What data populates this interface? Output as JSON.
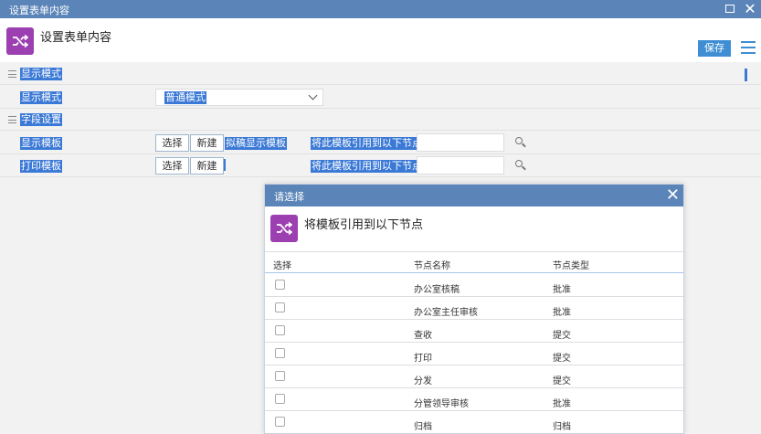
{
  "window": {
    "title": "设置表单内容"
  },
  "header": {
    "title": "设置表单内容",
    "save_label": "保存",
    "icon": "shuffle-icon",
    "list_icon": "list-icon"
  },
  "sections": {
    "display": {
      "label": "显示模式",
      "field_label": "显示模式",
      "select_value": "普通模式"
    },
    "fields": {
      "label": "字段设置",
      "display_template": {
        "label": "显示模板",
        "select_btn": "选择",
        "new_btn": "新建",
        "value": "拟稿显示模板",
        "apply_label": "将此模板引用到以下节点",
        "input_value": ""
      },
      "print_template": {
        "label": "打印模板",
        "select_btn": "选择",
        "new_btn": "新建",
        "apply_label": "将此模板引用到以下节点",
        "input_value": ""
      }
    }
  },
  "dialog": {
    "title": "请选择",
    "heading": "将模板引用到以下节点",
    "columns": [
      "选择",
      "节点名称",
      "节点类型"
    ],
    "rows": [
      {
        "name": "办公室核稿",
        "type": "批准"
      },
      {
        "name": "办公室主任审核",
        "type": "批准"
      },
      {
        "name": "查收",
        "type": "提交"
      },
      {
        "name": "打印",
        "type": "提交"
      },
      {
        "name": "分发",
        "type": "提交"
      },
      {
        "name": "分管领导审核",
        "type": "批准"
      },
      {
        "name": "归档",
        "type": "归档"
      }
    ]
  },
  "colors": {
    "titlebar": "#5b85b8",
    "accent": "#3f8ed3",
    "highlight": "#3b79d6",
    "icon_bg": "#9b3fb1"
  }
}
